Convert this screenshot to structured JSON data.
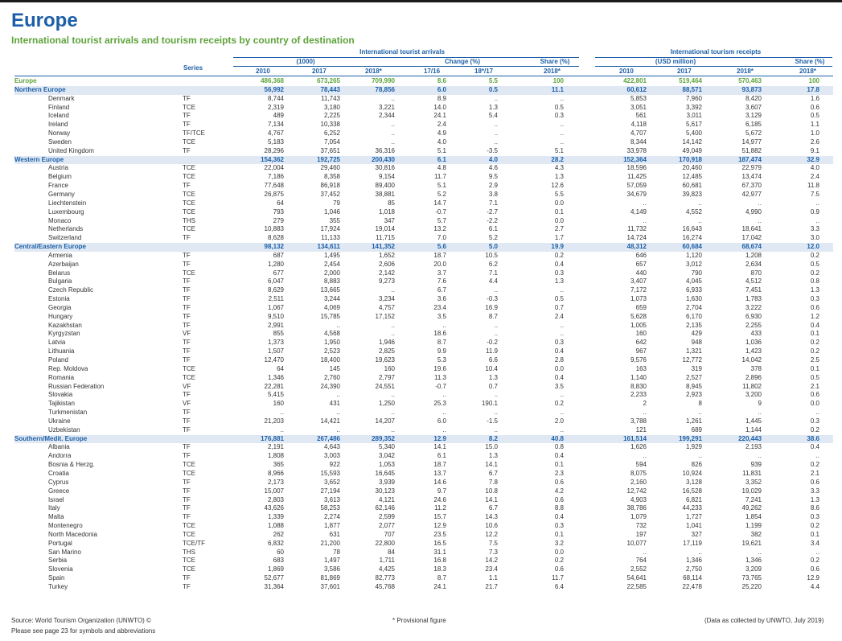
{
  "title": "Europe",
  "subtitle": "International tourist arrivals and tourism receipts by country of destination",
  "headers": {
    "arrivals_group": "International tourist arrivals",
    "unit_arrivals": "(1000)",
    "change": "Change (%)",
    "share": "Share (%)",
    "receipts_group": "International tourism receipts",
    "unit_receipts": "(USD million)",
    "share_r": "Share (%)",
    "series": "Series",
    "y2010": "2010",
    "y2017": "2017",
    "y2018": "2018*",
    "c1716": "17/16",
    "c1817": "18*/17",
    "s2018": "2018*",
    "r2010": "2010",
    "r2017": "2017",
    "r2018": "2018*",
    "rs2018": "2018*"
  },
  "rows": [
    {
      "t": "total",
      "name": "Europe",
      "s": "",
      "a10": "486,368",
      "a17": "673,265",
      "a18": "709,990",
      "c1": "8.6",
      "c2": "5.5",
      "sh": "100",
      "r10": "422,801",
      "r17": "519,464",
      "r18": "570,463",
      "rs": "100"
    },
    {
      "t": "region",
      "name": "Northern Europe",
      "s": "",
      "a10": "56,992",
      "a17": "78,443",
      "a18": "78,856",
      "c1": "6.0",
      "c2": "0.5",
      "sh": "11.1",
      "r10": "60,612",
      "r17": "88,571",
      "r18": "93,873",
      "rs": "17.8"
    },
    {
      "t": "country",
      "name": "Denmark",
      "s": "TF",
      "a10": "8,744",
      "a17": "11,743",
      "a18": "..",
      "c1": "8.9",
      "c2": "..",
      "sh": "..",
      "r10": "5,853",
      "r17": "7,960",
      "r18": "8,420",
      "rs": "1.6"
    },
    {
      "t": "country",
      "name": "Finland",
      "s": "TCE",
      "a10": "2,319",
      "a17": "3,180",
      "a18": "3,221",
      "c1": "14.0",
      "c2": "1.3",
      "sh": "0.5",
      "r10": "3,051",
      "r17": "3,392",
      "r18": "3,607",
      "rs": "0.6"
    },
    {
      "t": "country",
      "name": "Iceland",
      "s": "TF",
      "a10": "489",
      "a17": "2,225",
      "a18": "2,344",
      "c1": "24.1",
      "c2": "5.4",
      "sh": "0.3",
      "r10": "561",
      "r17": "3,011",
      "r18": "3,129",
      "rs": "0.5"
    },
    {
      "t": "country",
      "name": "Ireland",
      "s": "TF",
      "a10": "7,134",
      "a17": "10,338",
      "a18": "..",
      "c1": "2.4",
      "c2": "..",
      "sh": "..",
      "r10": "4,118",
      "r17": "5,617",
      "r18": "6,185",
      "rs": "1.1"
    },
    {
      "t": "country",
      "name": "Norway",
      "s": "TF/TCE",
      "a10": "4,767",
      "a17": "6,252",
      "a18": "..",
      "c1": "4.9",
      "c2": "..",
      "sh": "..",
      "r10": "4,707",
      "r17": "5,400",
      "r18": "5,672",
      "rs": "1.0"
    },
    {
      "t": "country",
      "name": "Sweden",
      "s": "TCE",
      "a10": "5,183",
      "a17": "7,054",
      "a18": "..",
      "c1": "4.0",
      "c2": "..",
      "sh": "..",
      "r10": "8,344",
      "r17": "14,142",
      "r18": "14,977",
      "rs": "2.6"
    },
    {
      "t": "country",
      "name": "United Kingdom",
      "s": "TF",
      "a10": "28,296",
      "a17": "37,651",
      "a18": "36,316",
      "c1": "5.1",
      "c2": "-3.5",
      "sh": "5.1",
      "r10": "33,978",
      "r17": "49,049",
      "r18": "51,882",
      "rs": "9.1"
    },
    {
      "t": "region",
      "name": "Western Europe",
      "s": "",
      "a10": "154,362",
      "a17": "192,725",
      "a18": "200,430",
      "c1": "6.1",
      "c2": "4.0",
      "sh": "28.2",
      "r10": "152,364",
      "r17": "170,918",
      "r18": "187,474",
      "rs": "32.9"
    },
    {
      "t": "country",
      "name": "Austria",
      "s": "TCE",
      "a10": "22,004",
      "a17": "29,460",
      "a18": "30,816",
      "c1": "4.8",
      "c2": "4.6",
      "sh": "4.3",
      "r10": "18,596",
      "r17": "20,460",
      "r18": "22,979",
      "rs": "4.0"
    },
    {
      "t": "country",
      "name": "Belgium",
      "s": "TCE",
      "a10": "7,186",
      "a17": "8,358",
      "a18": "9,154",
      "c1": "11.7",
      "c2": "9.5",
      "sh": "1.3",
      "r10": "11,425",
      "r17": "12,485",
      "r18": "13,474",
      "rs": "2.4"
    },
    {
      "t": "country",
      "name": "France",
      "s": "TF",
      "a10": "77,648",
      "a17": "86,918",
      "a18": "89,400",
      "c1": "5.1",
      "c2": "2.9",
      "sh": "12.6",
      "r10": "57,059",
      "r17": "60,681",
      "r18": "67,370",
      "rs": "11.8"
    },
    {
      "t": "country",
      "name": "Germany",
      "s": "TCE",
      "a10": "26,875",
      "a17": "37,452",
      "a18": "38,881",
      "c1": "5.2",
      "c2": "3.8",
      "sh": "5.5",
      "r10": "34,679",
      "r17": "39,823",
      "r18": "42,977",
      "rs": "7.5"
    },
    {
      "t": "country",
      "name": "Liechtenstein",
      "s": "TCE",
      "a10": "64",
      "a17": "79",
      "a18": "85",
      "c1": "14.7",
      "c2": "7.1",
      "sh": "0.0",
      "r10": "..",
      "r17": "..",
      "r18": "..",
      "rs": ".."
    },
    {
      "t": "country",
      "name": "Luxembourg",
      "s": "TCE",
      "a10": "793",
      "a17": "1,046",
      "a18": "1,018",
      "c1": "-0.7",
      "c2": "-2.7",
      "sh": "0.1",
      "r10": "4,149",
      "r17": "4,552",
      "r18": "4,990",
      "rs": "0.9"
    },
    {
      "t": "country",
      "name": "Monaco",
      "s": "THS",
      "a10": "279",
      "a17": "355",
      "a18": "347",
      "c1": "5.7",
      "c2": "-2.2",
      "sh": "0.0",
      "r10": "..",
      "r17": "..",
      "r18": "..",
      "rs": ".."
    },
    {
      "t": "country",
      "name": "Netherlands",
      "s": "TCE",
      "a10": "10,883",
      "a17": "17,924",
      "a18": "19,014",
      "c1": "13.2",
      "c2": "6.1",
      "sh": "2.7",
      "r10": "11,732",
      "r17": "16,643",
      "r18": "18,641",
      "rs": "3.3"
    },
    {
      "t": "country",
      "name": "Switzerland",
      "s": "TF",
      "a10": "8,628",
      "a17": "11,133",
      "a18": "11,715",
      "c1": "7.0",
      "c2": "5.2",
      "sh": "1.7",
      "r10": "14,724",
      "r17": "16,274",
      "r18": "17,042",
      "rs": "3.0"
    },
    {
      "t": "region",
      "name": "Central/Eastern Europe",
      "s": "",
      "a10": "98,132",
      "a17": "134,611",
      "a18": "141,352",
      "c1": "5.6",
      "c2": "5.0",
      "sh": "19.9",
      "r10": "48,312",
      "r17": "60,684",
      "r18": "68,674",
      "rs": "12.0"
    },
    {
      "t": "country",
      "name": "Armenia",
      "s": "TF",
      "a10": "687",
      "a17": "1,495",
      "a18": "1,652",
      "c1": "18.7",
      "c2": "10.5",
      "sh": "0.2",
      "r10": "646",
      "r17": "1,120",
      "r18": "1,208",
      "rs": "0.2"
    },
    {
      "t": "country",
      "name": "Azerbaijan",
      "s": "TF",
      "a10": "1,280",
      "a17": "2,454",
      "a18": "2,606",
      "c1": "20.0",
      "c2": "6.2",
      "sh": "0.4",
      "r10": "657",
      "r17": "3,012",
      "r18": "2,634",
      "rs": "0.5"
    },
    {
      "t": "country",
      "name": "Belarus",
      "s": "TCE",
      "a10": "677",
      "a17": "2,000",
      "a18": "2,142",
      "c1": "3.7",
      "c2": "7.1",
      "sh": "0.3",
      "r10": "440",
      "r17": "790",
      "r18": "870",
      "rs": "0.2"
    },
    {
      "t": "country",
      "name": "Bulgaria",
      "s": "TF",
      "a10": "6,047",
      "a17": "8,883",
      "a18": "9,273",
      "c1": "7.6",
      "c2": "4.4",
      "sh": "1.3",
      "r10": "3,407",
      "r17": "4,045",
      "r18": "4,512",
      "rs": "0.8"
    },
    {
      "t": "country",
      "name": "Czech Republic",
      "s": "TF",
      "a10": "8,629",
      "a17": "13,665",
      "a18": "..",
      "c1": "6.7",
      "c2": "..",
      "sh": "..",
      "r10": "7,172",
      "r17": "6,933",
      "r18": "7,451",
      "rs": "1.3"
    },
    {
      "t": "country",
      "name": "Estonia",
      "s": "TF",
      "a10": "2,511",
      "a17": "3,244",
      "a18": "3,234",
      "c1": "3.6",
      "c2": "-0.3",
      "sh": "0.5",
      "r10": "1,073",
      "r17": "1,630",
      "r18": "1,783",
      "rs": "0.3"
    },
    {
      "t": "country",
      "name": "Georgia",
      "s": "TF",
      "a10": "1,067",
      "a17": "4,069",
      "a18": "4,757",
      "c1": "23.4",
      "c2": "16.9",
      "sh": "0.7",
      "r10": "659",
      "r17": "2,704",
      "r18": "3,222",
      "rs": "0.6"
    },
    {
      "t": "country",
      "name": "Hungary",
      "s": "TF",
      "a10": "9,510",
      "a17": "15,785",
      "a18": "17,152",
      "c1": "3.5",
      "c2": "8.7",
      "sh": "2.4",
      "r10": "5,628",
      "r17": "6,170",
      "r18": "6,930",
      "rs": "1.2"
    },
    {
      "t": "country",
      "name": "Kazakhstan",
      "s": "TF",
      "a10": "2,991",
      "a17": "..",
      "a18": "..",
      "c1": "..",
      "c2": "..",
      "sh": "..",
      "r10": "1,005",
      "r17": "2,135",
      "r18": "2,255",
      "rs": "0.4"
    },
    {
      "t": "country",
      "name": "Kyrgyzstan",
      "s": "VF",
      "a10": "855",
      "a17": "4,568",
      "a18": "..",
      "c1": "18.6",
      "c2": "..",
      "sh": "..",
      "r10": "160",
      "r17": "429",
      "r18": "433",
      "rs": "0.1"
    },
    {
      "t": "country",
      "name": "Latvia",
      "s": "TF",
      "a10": "1,373",
      "a17": "1,950",
      "a18": "1,946",
      "c1": "8.7",
      "c2": "-0.2",
      "sh": "0.3",
      "r10": "642",
      "r17": "948",
      "r18": "1,036",
      "rs": "0.2"
    },
    {
      "t": "country",
      "name": "Lithuania",
      "s": "TF",
      "a10": "1,507",
      "a17": "2,523",
      "a18": "2,825",
      "c1": "9.9",
      "c2": "11.9",
      "sh": "0.4",
      "r10": "967",
      "r17": "1,321",
      "r18": "1,423",
      "rs": "0.2"
    },
    {
      "t": "country",
      "name": "Poland",
      "s": "TF",
      "a10": "12,470",
      "a17": "18,400",
      "a18": "19,623",
      "c1": "5.3",
      "c2": "6.6",
      "sh": "2.8",
      "r10": "9,576",
      "r17": "12,772",
      "r18": "14,042",
      "rs": "2.5"
    },
    {
      "t": "country",
      "name": "Rep. Moldova",
      "s": "TCE",
      "a10": "64",
      "a17": "145",
      "a18": "160",
      "c1": "19.6",
      "c2": "10.4",
      "sh": "0.0",
      "r10": "163",
      "r17": "319",
      "r18": "378",
      "rs": "0.1"
    },
    {
      "t": "country",
      "name": "Romania",
      "s": "TCE",
      "a10": "1,346",
      "a17": "2,760",
      "a18": "2,797",
      "c1": "11.3",
      "c2": "1.3",
      "sh": "0.4",
      "r10": "1,140",
      "r17": "2,527",
      "r18": "2,896",
      "rs": "0.5"
    },
    {
      "t": "country",
      "name": "Russian Federation",
      "s": "VF",
      "a10": "22,281",
      "a17": "24,390",
      "a18": "24,551",
      "c1": "-0.7",
      "c2": "0.7",
      "sh": "3.5",
      "r10": "8,830",
      "r17": "8,945",
      "r18": "11,802",
      "rs": "2.1"
    },
    {
      "t": "country",
      "name": "Slovakia",
      "s": "TF",
      "a10": "5,415",
      "a17": "..",
      "a18": "..",
      "c1": "..",
      "c2": "..",
      "sh": "..",
      "r10": "2,233",
      "r17": "2,923",
      "r18": "3,200",
      "rs": "0.6"
    },
    {
      "t": "country",
      "name": "Tajikistan",
      "s": "VF",
      "a10": "160",
      "a17": "431",
      "a18": "1,250",
      "c1": "25.3",
      "c2": "190.1",
      "sh": "0.2",
      "r10": "2",
      "r17": "8",
      "r18": "9",
      "rs": "0.0"
    },
    {
      "t": "country",
      "name": "Turkmenistan",
      "s": "TF",
      "a10": "..",
      "a17": "..",
      "a18": "..",
      "c1": "..",
      "c2": "..",
      "sh": "..",
      "r10": "..",
      "r17": "..",
      "r18": "..",
      "rs": ".."
    },
    {
      "t": "country",
      "name": "Ukraine",
      "s": "TF",
      "a10": "21,203",
      "a17": "14,421",
      "a18": "14,207",
      "c1": "6.0",
      "c2": "-1.5",
      "sh": "2.0",
      "r10": "3,788",
      "r17": "1,261",
      "r18": "1,445",
      "rs": "0.3"
    },
    {
      "t": "country",
      "name": "Uzbekistan",
      "s": "TF",
      "a10": "..",
      "a17": "..",
      "a18": "..",
      "c1": "..",
      "c2": "..",
      "sh": "..",
      "r10": "121",
      "r17": "689",
      "r18": "1,144",
      "rs": "0.2"
    },
    {
      "t": "region",
      "name": "Southern/Medit. Europe",
      "s": "",
      "a10": "176,881",
      "a17": "267,486",
      "a18": "289,352",
      "c1": "12.9",
      "c2": "8.2",
      "sh": "40.8",
      "r10": "161,514",
      "r17": "199,291",
      "r18": "220,443",
      "rs": "38.6"
    },
    {
      "t": "country",
      "name": "Albania",
      "s": "TF",
      "a10": "2,191",
      "a17": "4,643",
      "a18": "5,340",
      "c1": "14.1",
      "c2": "15.0",
      "sh": "0.8",
      "r10": "1,626",
      "r17": "1,929",
      "r18": "2,193",
      "rs": "0.4"
    },
    {
      "t": "country",
      "name": "Andorra",
      "s": "TF",
      "a10": "1,808",
      "a17": "3,003",
      "a18": "3,042",
      "c1": "6.1",
      "c2": "1.3",
      "sh": "0.4",
      "r10": "..",
      "r17": "..",
      "r18": "..",
      "rs": ".."
    },
    {
      "t": "country",
      "name": "Bosnia & Herzg.",
      "s": "TCE",
      "a10": "365",
      "a17": "922",
      "a18": "1,053",
      "c1": "18.7",
      "c2": "14.1",
      "sh": "0.1",
      "r10": "594",
      "r17": "826",
      "r18": "939",
      "rs": "0.2"
    },
    {
      "t": "country",
      "name": "Croatia",
      "s": "TCE",
      "a10": "8,966",
      "a17": "15,593",
      "a18": "16,645",
      "c1": "13.7",
      "c2": "6.7",
      "sh": "2.3",
      "r10": "8,075",
      "r17": "10,924",
      "r18": "11,831",
      "rs": "2.1"
    },
    {
      "t": "country",
      "name": "Cyprus",
      "s": "TF",
      "a10": "2,173",
      "a17": "3,652",
      "a18": "3,939",
      "c1": "14.6",
      "c2": "7.8",
      "sh": "0.6",
      "r10": "2,160",
      "r17": "3,128",
      "r18": "3,352",
      "rs": "0.6"
    },
    {
      "t": "country",
      "name": "Greece",
      "s": "TF",
      "a10": "15,007",
      "a17": "27,194",
      "a18": "30,123",
      "c1": "9.7",
      "c2": "10.8",
      "sh": "4.2",
      "r10": "12,742",
      "r17": "16,528",
      "r18": "19,029",
      "rs": "3.3"
    },
    {
      "t": "country",
      "name": "Israel",
      "s": "TF",
      "a10": "2,803",
      "a17": "3,613",
      "a18": "4,121",
      "c1": "24.6",
      "c2": "14.1",
      "sh": "0.6",
      "r10": "4,903",
      "r17": "6,821",
      "r18": "7,241",
      "rs": "1.3"
    },
    {
      "t": "country",
      "name": "Italy",
      "s": "TF",
      "a10": "43,626",
      "a17": "58,253",
      "a18": "62,146",
      "c1": "11.2",
      "c2": "6.7",
      "sh": "8.8",
      "r10": "38,786",
      "r17": "44,233",
      "r18": "49,262",
      "rs": "8.6"
    },
    {
      "t": "country",
      "name": "Malta",
      "s": "TF",
      "a10": "1,339",
      "a17": "2,274",
      "a18": "2,599",
      "c1": "15.7",
      "c2": "14.3",
      "sh": "0.4",
      "r10": "1,079",
      "r17": "1,727",
      "r18": "1,854",
      "rs": "0.3"
    },
    {
      "t": "country",
      "name": "Montenegro",
      "s": "TCE",
      "a10": "1,088",
      "a17": "1,877",
      "a18": "2,077",
      "c1": "12.9",
      "c2": "10.6",
      "sh": "0.3",
      "r10": "732",
      "r17": "1,041",
      "r18": "1,199",
      "rs": "0.2"
    },
    {
      "t": "country",
      "name": "North Macedonia",
      "s": "TCE",
      "a10": "262",
      "a17": "631",
      "a18": "707",
      "c1": "23.5",
      "c2": "12.2",
      "sh": "0.1",
      "r10": "197",
      "r17": "327",
      "r18": "382",
      "rs": "0.1"
    },
    {
      "t": "country",
      "name": "Portugal",
      "s": "TCE/TF",
      "a10": "6,832",
      "a17": "21,200",
      "a18": "22,800",
      "c1": "16.5",
      "c2": "7.5",
      "sh": "3.2",
      "r10": "10,077",
      "r17": "17,119",
      "r18": "19,621",
      "rs": "3.4"
    },
    {
      "t": "country",
      "name": "San Marino",
      "s": "THS",
      "a10": "60",
      "a17": "78",
      "a18": "84",
      "c1": "31.1",
      "c2": "7.3",
      "sh": "0.0",
      "r10": "..",
      "r17": "..",
      "r18": "..",
      "rs": ".."
    },
    {
      "t": "country",
      "name": "Serbia",
      "s": "TCE",
      "a10": "683",
      "a17": "1,497",
      "a18": "1,711",
      "c1": "16.8",
      "c2": "14.2",
      "sh": "0.2",
      "r10": "764",
      "r17": "1,346",
      "r18": "1,346",
      "rs": "0.2"
    },
    {
      "t": "country",
      "name": "Slovenia",
      "s": "TCE",
      "a10": "1,869",
      "a17": "3,586",
      "a18": "4,425",
      "c1": "18.3",
      "c2": "23.4",
      "sh": "0.6",
      "r10": "2,552",
      "r17": "2,750",
      "r18": "3,209",
      "rs": "0.6"
    },
    {
      "t": "country",
      "name": "Spain",
      "s": "TF",
      "a10": "52,677",
      "a17": "81,869",
      "a18": "82,773",
      "c1": "8.7",
      "c2": "1.1",
      "sh": "11.7",
      "r10": "54,641",
      "r17": "68,114",
      "r18": "73,765",
      "rs": "12.9"
    },
    {
      "t": "country",
      "name": "Turkey",
      "s": "TF",
      "a10": "31,364",
      "a17": "37,601",
      "a18": "45,768",
      "c1": "24.1",
      "c2": "21.7",
      "sh": "6.4",
      "r10": "22,585",
      "r17": "22,478",
      "r18": "25,220",
      "rs": "4.4"
    }
  ],
  "footer": {
    "source": "Source: World Tourism Organization (UNWTO) ©",
    "page_note": "Please see page 23 for symbols and abbreviations",
    "provisional": "* Provisional figure",
    "data_note": "(Data as collected by UNWTO, July 2019)"
  }
}
